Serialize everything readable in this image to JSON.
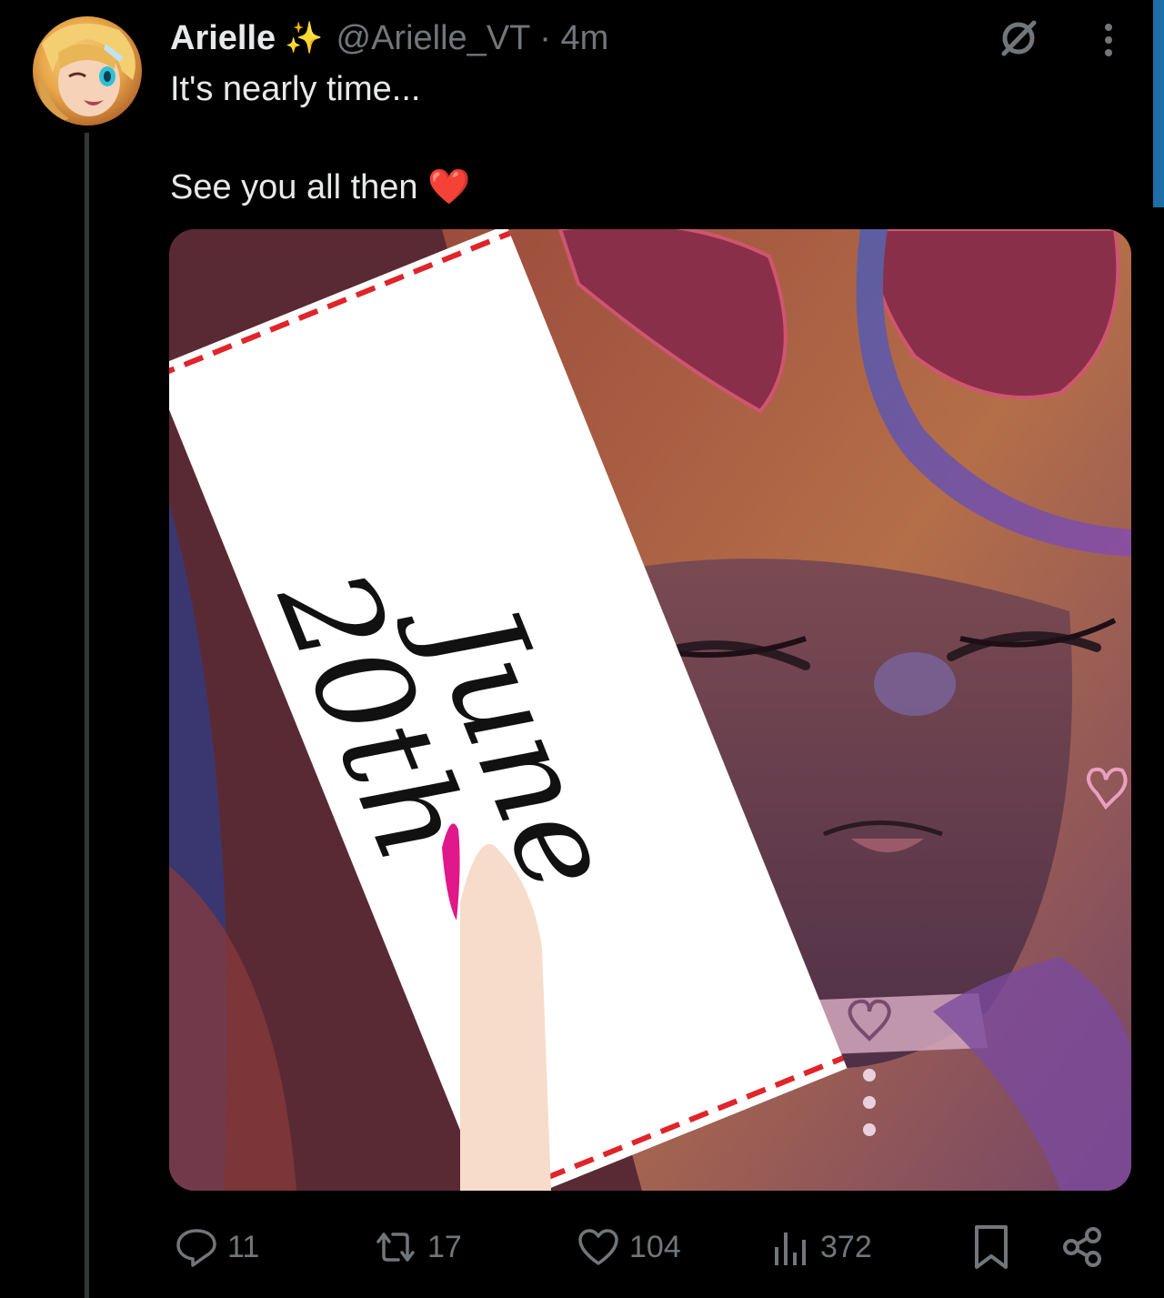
{
  "post": {
    "author_name": "Arielle",
    "author_emoji": "✨",
    "handle_time": "@Arielle_VT · 4m",
    "text_line1": "It's nearly time...",
    "text_line2": "See you all then",
    "text_emoji": "❤️"
  },
  "media": {
    "card_line1": "June",
    "card_line2": "20th"
  },
  "actions": {
    "replies": "11",
    "reposts": "17",
    "likes": "104",
    "views": "372"
  },
  "colors": {
    "background": "#000000",
    "text_primary": "#e7e9ea",
    "text_secondary": "#71767b",
    "heart": "#e0245e",
    "card_dash": "#e0242a"
  },
  "icons": [
    "grok-icon",
    "more-icon",
    "reply-icon",
    "repost-icon",
    "like-icon",
    "views-icon",
    "bookmark-icon",
    "share-icon"
  ]
}
